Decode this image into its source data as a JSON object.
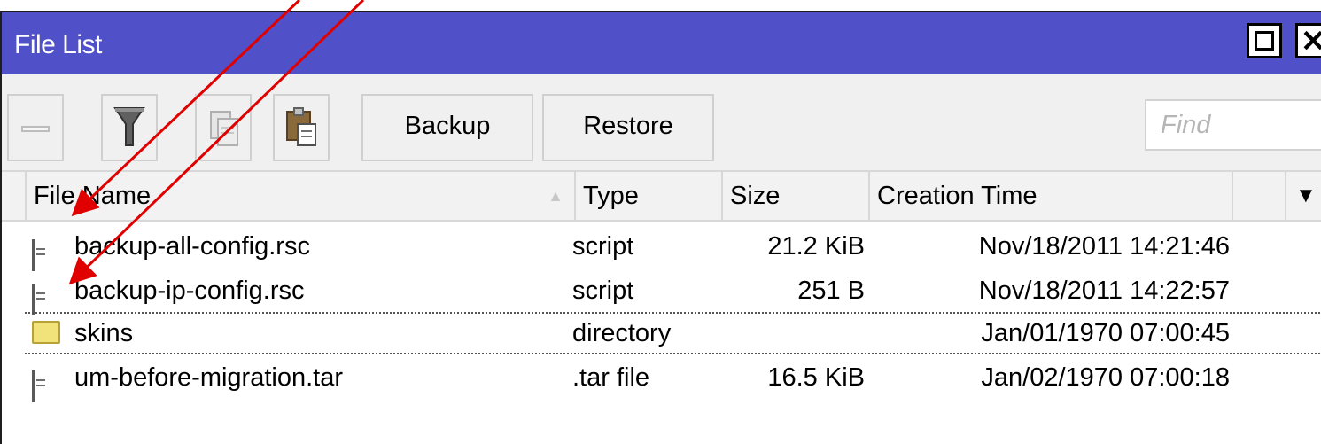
{
  "window": {
    "title": "File List"
  },
  "toolbar": {
    "backup_label": "Backup",
    "restore_label": "Restore",
    "find_placeholder": "Find"
  },
  "table": {
    "columns": {
      "name": "File Name",
      "type": "Type",
      "size": "Size",
      "creation_time": "Creation Time"
    },
    "rows": [
      {
        "icon": "document-icon",
        "name": "backup-all-config.rsc",
        "type": "script",
        "size": "21.2 KiB",
        "creation_time": "Nov/18/2011 14:21:46"
      },
      {
        "icon": "document-icon",
        "name": "backup-ip-config.rsc",
        "type": "script",
        "size": "251 B",
        "creation_time": "Nov/18/2011 14:22:57"
      },
      {
        "icon": "folder-icon",
        "name": "skins",
        "type": "directory",
        "size": "",
        "creation_time": "Jan/01/1970 07:00:45"
      },
      {
        "icon": "document-icon",
        "name": "um-before-migration.tar",
        "type": ".tar file",
        "size": "16.5 KiB",
        "creation_time": "Jan/02/1970 07:00:18"
      }
    ]
  },
  "icons": {
    "minimize": "minus-icon",
    "filter": "filter-icon",
    "copy": "copy-icon",
    "paste": "paste-icon",
    "maximize": "maximize-icon",
    "close": "close-icon",
    "sort": "sort-ascending-icon",
    "column_menu": "dropdown-arrow-icon"
  },
  "colors": {
    "titlebar": "#5050c8",
    "annotation_arrow": "#e00000",
    "toolbar_bg": "#f0f0f0"
  }
}
